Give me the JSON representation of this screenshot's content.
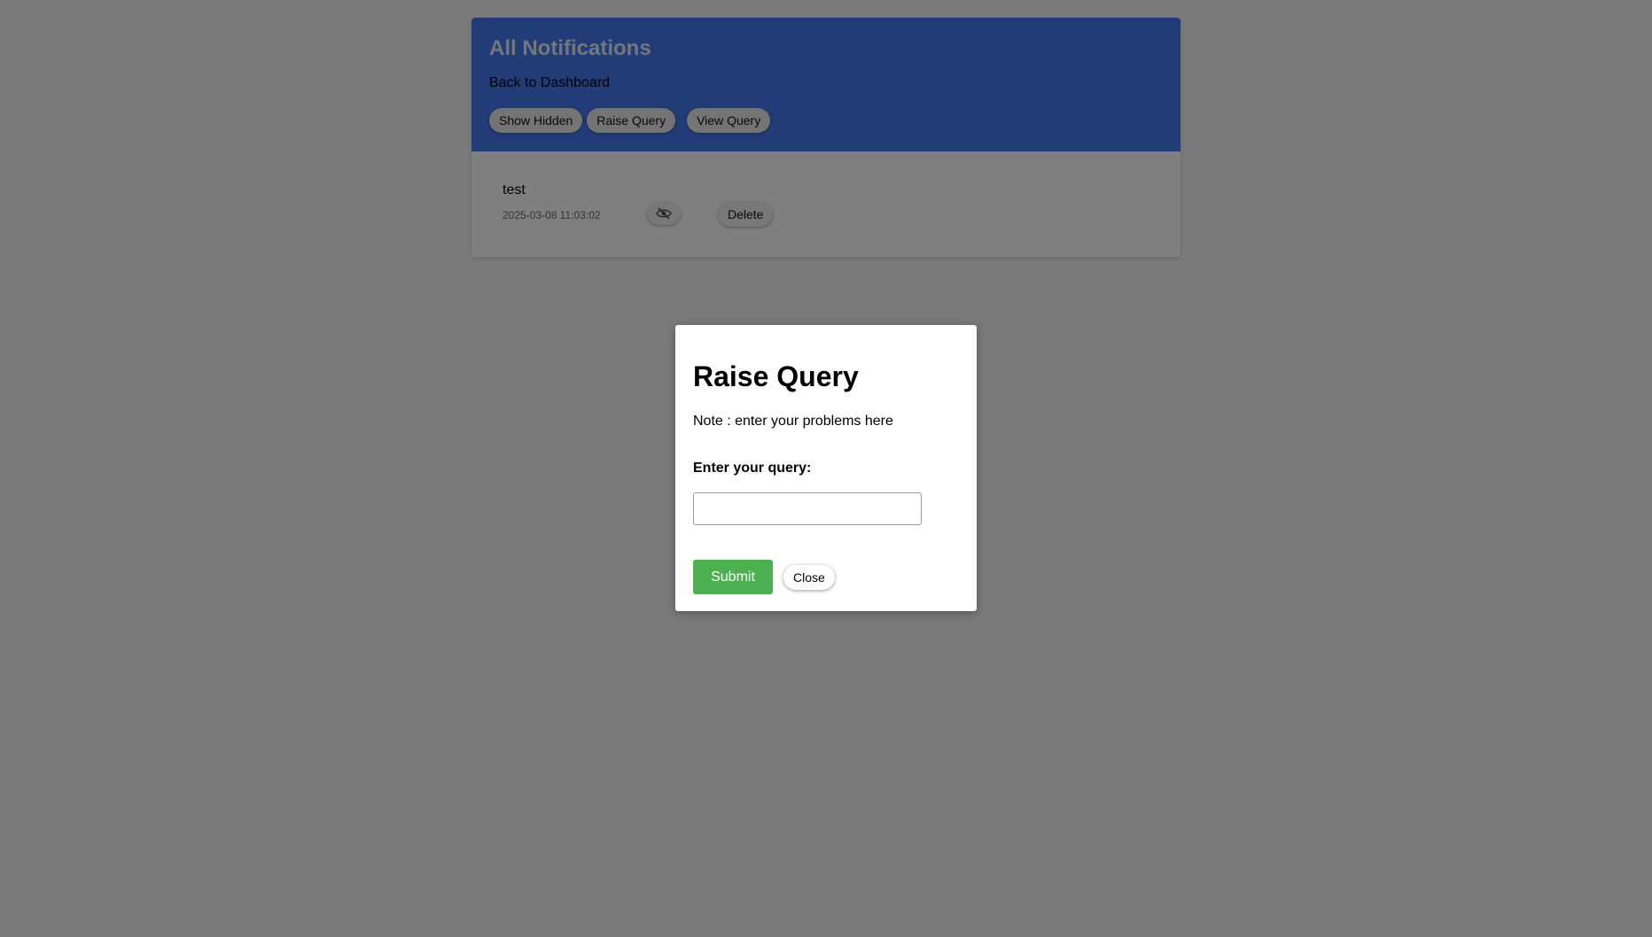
{
  "header": {
    "title": "All Notifications",
    "back_link": "Back to Dashboard",
    "buttons": {
      "show_hidden": "Show Hidden",
      "raise_query": "Raise Query",
      "view_query": "View Query"
    }
  },
  "notifications": [
    {
      "title": "test",
      "timestamp": "2025-03-08 11:03:02",
      "hide_icon": "eye-slash-icon",
      "delete_label": "Delete"
    }
  ],
  "modal": {
    "title": "Raise Query",
    "note": "Note : enter your problems here",
    "query_label": "Enter your query:",
    "query_value": "",
    "submit_label": "Submit",
    "close_label": "Close"
  },
  "colors": {
    "header_bg": "#4478f0",
    "submit_bg": "#4caf50",
    "overlay": "rgba(0,0,0,0.5)"
  }
}
